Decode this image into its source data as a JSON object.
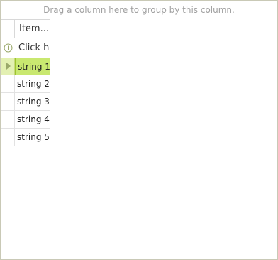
{
  "group_panel": {
    "hint": "Drag a column here to group by this column."
  },
  "columns": [
    {
      "header": "Item..."
    }
  ],
  "new_row": {
    "label": "Click h"
  },
  "rows": [
    {
      "value": "string 1",
      "selected": true
    },
    {
      "value": "string 2",
      "selected": false
    },
    {
      "value": "string 3",
      "selected": false
    },
    {
      "value": "string 4",
      "selected": false
    },
    {
      "value": "string 5",
      "selected": false
    }
  ],
  "colors": {
    "selection": "#c9e870",
    "border": "#c9c9b6"
  },
  "icons": {
    "add_row": "plus-circle-icon",
    "current_row": "triangle-right-icon"
  }
}
